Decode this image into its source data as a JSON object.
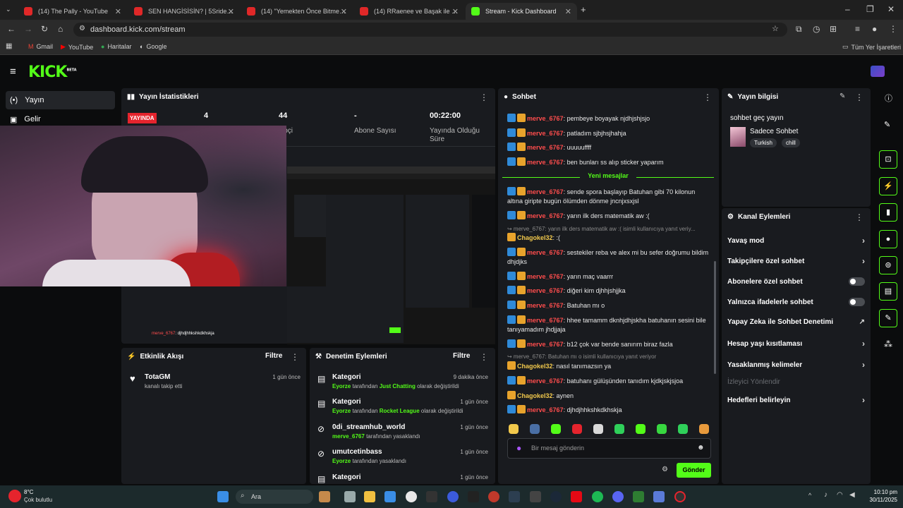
{
  "browser": {
    "tabs": [
      {
        "title": "(14) The Pally - YouTube",
        "icon": "youtube-icon"
      },
      {
        "title": "SEN HANGİSİSİN? | 5Sriders | M",
        "icon": "youtube-icon"
      },
      {
        "title": "(14) \"Yemekten Önce Bitmeyen",
        "icon": "youtube-icon"
      },
      {
        "title": "(14) RRaenee ve Başak ile soru",
        "icon": "youtube-icon"
      },
      {
        "title": "Stream - Kick Dashboard",
        "icon": "kick-icon"
      }
    ],
    "url": "dashboard.kick.com/stream",
    "bookmarks": [
      "Gmail",
      "YouTube",
      "Haritalar",
      "Google"
    ],
    "all_bookmarks": "Tüm Yer İşaretleri"
  },
  "kick": {
    "logo": "KICK",
    "logo_badge": "BETA",
    "sidebar": [
      "Yayın",
      "Gelir"
    ],
    "stats": {
      "title": "Yayın İstatistikleri",
      "live": "YAYINDA",
      "viewers": "4",
      "followers_value": "44",
      "followers_label": "kipçi",
      "subs_value": "-",
      "subs_label": "Abone Sayısı",
      "uptime_value": "00:22:00",
      "uptime_label": "Yayında Olduğu Süre"
    },
    "activity": {
      "title": "Etkinlik Akışı",
      "filter": "Filtre",
      "items": [
        {
          "user": "TotaGM",
          "text": "kanalı takip etti",
          "time": "1 gün önce"
        }
      ]
    },
    "moderation": {
      "title": "Denetim Eylemleri",
      "filter": "Filtre",
      "items": [
        {
          "title": "Kategori",
          "who": "Eyorze",
          "mid": "tarafından",
          "target": "Just Chatting",
          "end": "olarak değiştirildi",
          "time": "9 dakika önce"
        },
        {
          "title": "Kategori",
          "who": "Eyorze",
          "mid": "tarafından",
          "target": "Rocket League",
          "end": "olarak değiştirildi",
          "time": "1 gün önce"
        },
        {
          "title": "0di_streamhub_world",
          "who": "merve_6767",
          "mid": "tarafından yasaklandı",
          "target": "",
          "end": "",
          "time": "1 gün önce"
        },
        {
          "title": "umutcetinbass",
          "who": "Eyorze",
          "mid": "tarafından yasaklandı",
          "target": "",
          "end": "",
          "time": "1 gün önce"
        },
        {
          "title": "Kategori",
          "who": "",
          "mid": "",
          "target": "",
          "end": "",
          "time": "1 gün önce"
        }
      ]
    },
    "chat": {
      "title": "Sohbet",
      "new_messages": "Yeni mesajlar",
      "messages": [
        {
          "user": "merve_6767",
          "text": ": pembeye boyayak njdhjshjsjo"
        },
        {
          "user": "merve_6767",
          "text": ": patladım sjbjhsjhahja"
        },
        {
          "user": "merve_6767",
          "text": ": uuuuuffff"
        },
        {
          "user": "merve_6767",
          "text": ": ben bunları ss alıp sticker yaparım"
        },
        {
          "user": "merve_6767",
          "text": ": sende spora başlayıp Batuhan gibi 70 kilonun altına giripte bugün ölümden dönme jncnjxsxjsl"
        },
        {
          "user": "merve_6767",
          "text": ": yarın ilk ders matematik aw :("
        },
        {
          "user": "Chagokel32",
          "text": ": :("
        },
        {
          "user": "merve_6767",
          "text": ": sestekiler reba ve alex mi bu sefer doğrumu bildim dhjdjks"
        },
        {
          "user": "merve_6767",
          "text": ": yarın maç vaarrr"
        },
        {
          "user": "merve_6767",
          "text": ": diğeri kim djhhjshjjka"
        },
        {
          "user": "merve_6767",
          "text": ": Batuhan mı o"
        },
        {
          "user": "merve_6767",
          "text": ": hhee tamamm dknhjdhjskha batuhanın sesini bile tanıyamadım jhdjjaja"
        },
        {
          "user": "merve_6767",
          "text": ": b12 çok var bende sanırım biraz fazla"
        },
        {
          "user": "Chagokel32",
          "text": ": nasıl tanımazsın ya"
        },
        {
          "user": "merve_6767",
          "text": ": batuhanı gülüşünden tanıdım kjdkjskjsjoa"
        },
        {
          "user": "Chagokel32",
          "text": ": aynen"
        },
        {
          "user": "merve_6767",
          "text": ": djhdjhhkshkdkhskja"
        }
      ],
      "replies": [
        "↪ merve_6767: yarın ilk ders matematik aw :( isimli kullanıcıya yanıt veriy...",
        "↪ merve_6767: Batuhan mı o isimli kullanıcıya yanıt veriyor"
      ],
      "input_placeholder": "Bir mesaj gönderin",
      "send": "Gönder"
    },
    "stream_info": {
      "title": "Yayın bilgisi",
      "stream_title": "sohbet geç yayın",
      "category": "Sadece Sohbet",
      "tags": [
        "Turkish",
        "chill"
      ]
    },
    "channel_actions": {
      "title": "Kanal Eylemleri",
      "items": [
        {
          "label": "Yavaş mod",
          "control": "chevron"
        },
        {
          "label": "Takipçilere özel sohbet",
          "control": "chevron"
        },
        {
          "label": "Abonelere özel sohbet",
          "control": "toggle"
        },
        {
          "label": "Yalnızca ifadelerle sohbet",
          "control": "toggle"
        },
        {
          "label": "Yapay Zeka ile Sohbet Denetimi",
          "control": "external"
        },
        {
          "label": "Hesap yaşı kısıtlaması",
          "control": "chevron"
        },
        {
          "label": "Yasaklanmış kelimeler",
          "control": "chevron"
        },
        {
          "label": "İzleyici Yönlendir",
          "control": "none"
        },
        {
          "label": "Hedefleri belirleyin",
          "control": "chevron"
        }
      ]
    },
    "preview_overlay": {
      "user": "merve_6767",
      "text": "djhdjhhkshkdkhskja"
    }
  },
  "taskbar": {
    "weather_temp": "8°C",
    "weather_desc": "Çok bulutlu",
    "search": "Ara",
    "time": "10:10 pm",
    "date": "30/11/2025"
  },
  "colors": {
    "accent": "#53fc18",
    "live": "#e5242d",
    "panel": "#191b1f",
    "username": "#ff4d4d"
  }
}
